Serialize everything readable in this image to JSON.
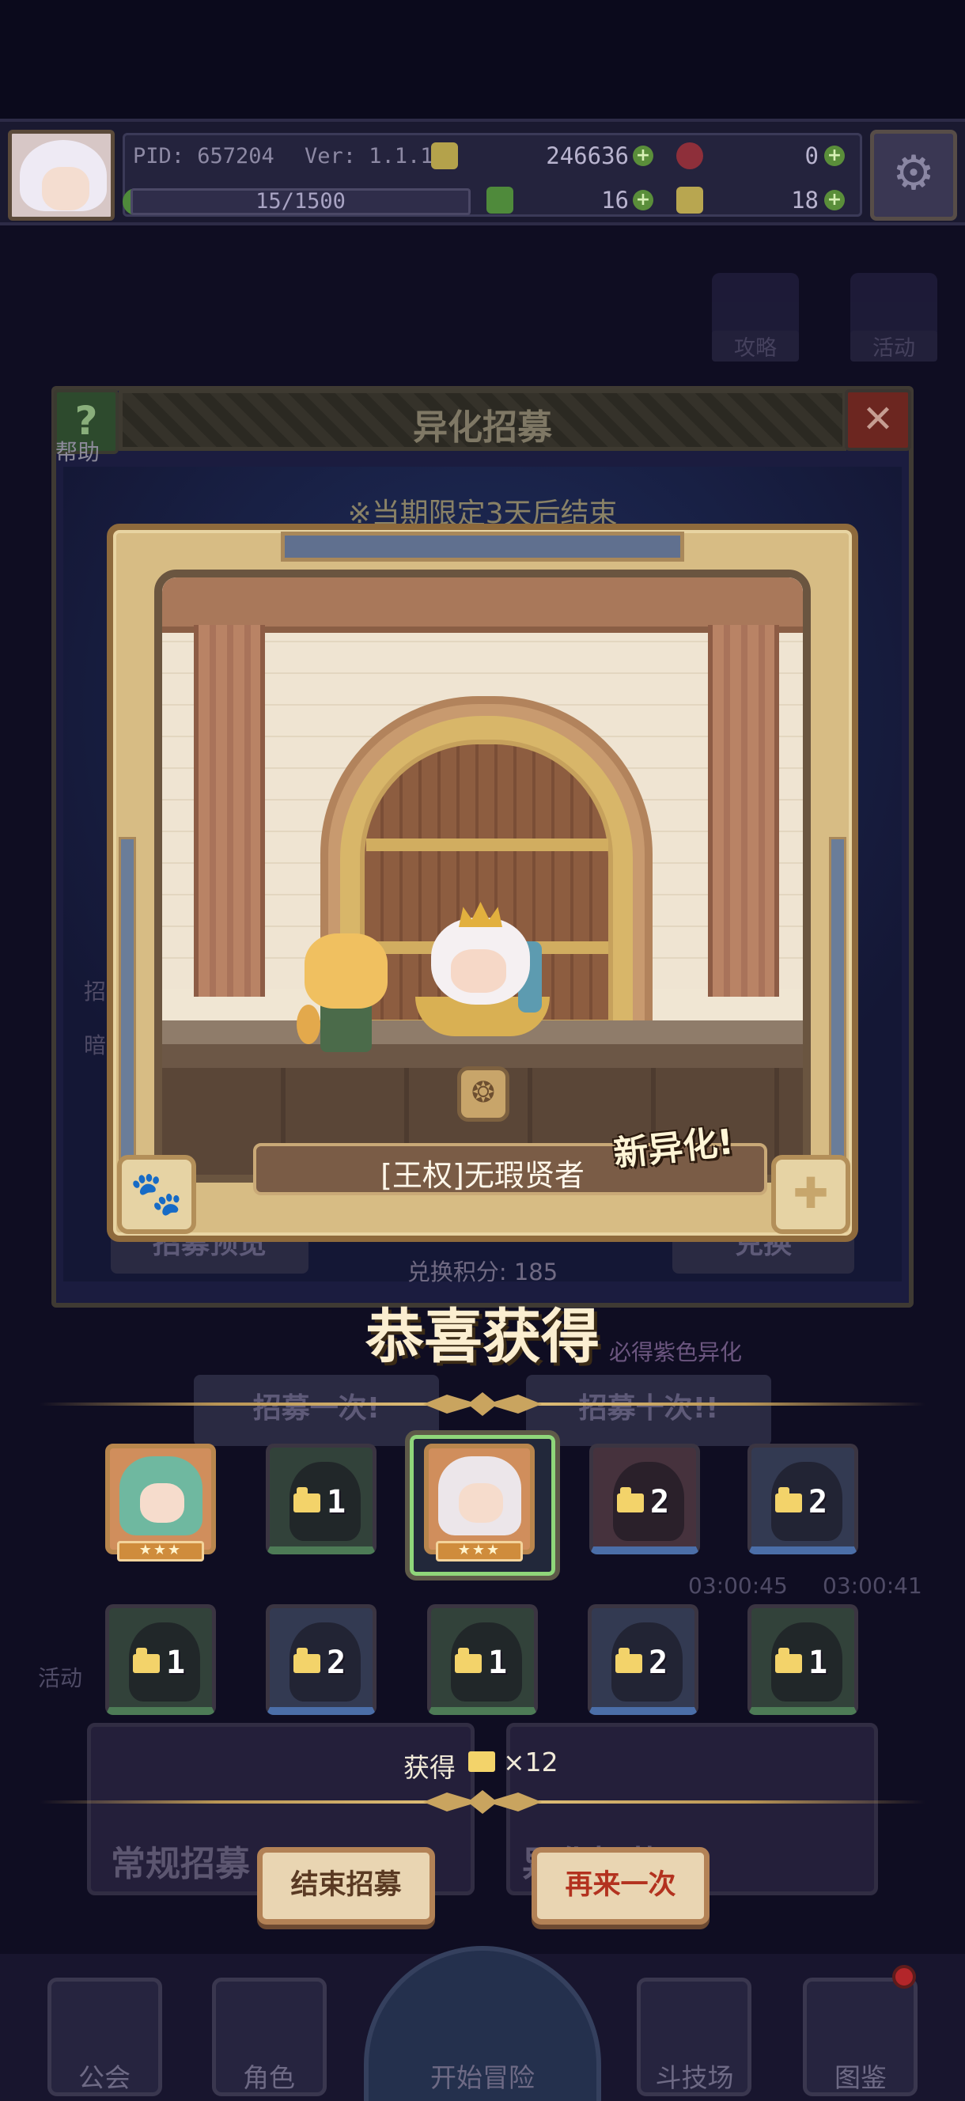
{
  "hud": {
    "pid": "PID: 657204",
    "version": "Ver: 1.1.1.7",
    "gold": "246636",
    "gems": "0",
    "stamina": "15/1500",
    "clover": "16",
    "shards": "18"
  },
  "shortcuts": {
    "guide": "攻略",
    "event": "活动"
  },
  "recruit": {
    "title": "异化招募",
    "help_label": "帮助",
    "close_icon": "✕",
    "limit_note": "※当期限定3天后结束",
    "preview_button": "招募预览",
    "exchange_button": "兑换",
    "score": "兑换积分: 185",
    "guarantee_note": "必得紫色异化",
    "recruit_once": "招募一次!",
    "recruit_ten": "招募十次!!",
    "timer_a": "03:00:45",
    "timer_b": "03:00:41",
    "side_a": "招",
    "side_b": "暗",
    "side_c": "活动"
  },
  "showcase": {
    "name": "[王权]无瑕贤者",
    "new_tag": "新异化!"
  },
  "result": {
    "title": "恭喜获得",
    "gain_label": "获得",
    "gain_count": "×12",
    "stars": "★★★",
    "slots_row1": [
      {
        "type": "character",
        "portrait": "teal"
      },
      {
        "type": "fragment",
        "count": "1",
        "tint": "green"
      },
      {
        "type": "character",
        "portrait": "white",
        "highlight": true
      },
      {
        "type": "fragment",
        "count": "2",
        "tint": "red"
      },
      {
        "type": "fragment",
        "count": "2",
        "tint": "blue"
      }
    ],
    "slots_row2": [
      {
        "type": "fragment",
        "count": "1",
        "tint": "green"
      },
      {
        "type": "fragment",
        "count": "2",
        "tint": "blue"
      },
      {
        "type": "fragment",
        "count": "1",
        "tint": "green"
      },
      {
        "type": "fragment",
        "count": "2",
        "tint": "blue"
      },
      {
        "type": "fragment",
        "count": "1",
        "tint": "green"
      }
    ]
  },
  "banners": {
    "normal_recruit": "常规招募",
    "other_recruit": "异化招募"
  },
  "actions": {
    "end": "结束招募",
    "again": "再来一次"
  },
  "nav": {
    "guild": "公会",
    "character": "角色",
    "adventure": "开始冒险",
    "arena": "斗技场",
    "codex": "图鉴"
  },
  "colors": {
    "accent_gold": "#e6c67e",
    "again_text": "#b3321f",
    "highlight_green": "#8fd67a"
  }
}
